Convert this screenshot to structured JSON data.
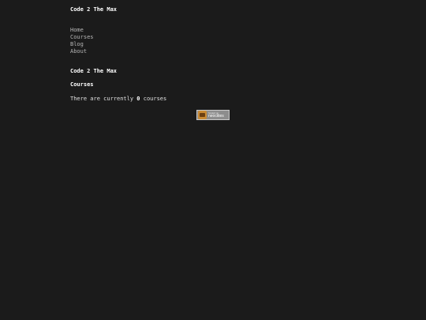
{
  "site": {
    "title": "Code 2 The Max"
  },
  "nav": {
    "items": [
      {
        "label": "Home"
      },
      {
        "label": "Courses"
      },
      {
        "label": "Blog"
      },
      {
        "label": "About"
      }
    ]
  },
  "main": {
    "section_title": "Code 2 The Max",
    "heading": "Courses",
    "info_prefix": "There are currently ",
    "course_count": "0",
    "info_suffix": " courses"
  },
  "badge": {
    "small_text": "hosted on",
    "label": "neocities",
    "icon": "neocities-cat-icon"
  }
}
